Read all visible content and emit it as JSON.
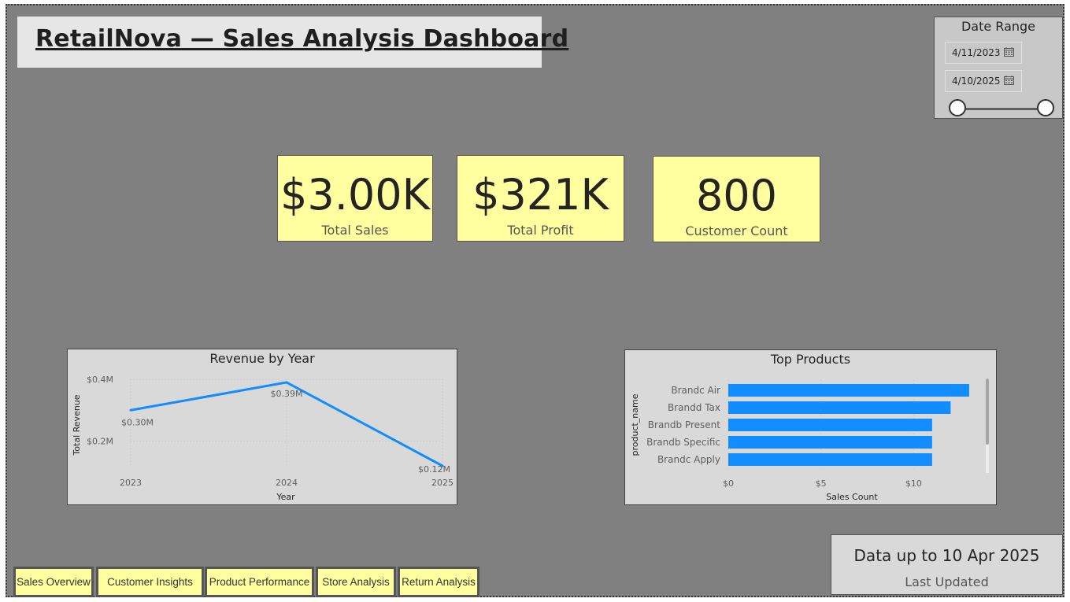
{
  "header": {
    "title": "RetailNova — Sales Analysis Dashboard"
  },
  "date_range": {
    "label": "Date Range",
    "start": "4/11/2023",
    "end": "4/10/2025",
    "calendar_icon": "calendar-icon",
    "slider_start_fraction": 0.0,
    "slider_end_fraction": 1.0
  },
  "kpis": [
    {
      "value": "$3.00K",
      "label": "Total Sales"
    },
    {
      "value": "$321K",
      "label": "Total Profit"
    },
    {
      "value": "800",
      "label": "Customer Count"
    }
  ],
  "colors": {
    "background": "#808080",
    "kpi_card": "#ffff9f",
    "chart_bg": "#d9d9d9",
    "series": "#118dff"
  },
  "chart_data": [
    {
      "type": "line",
      "title": "Revenue by Year",
      "xlabel": "Year",
      "ylabel": "Total Revenue",
      "x": [
        "2023",
        "2024",
        "2025"
      ],
      "values": [
        0.3,
        0.39,
        0.12
      ],
      "data_labels": [
        "$0.30M",
        "$0.39M",
        "$0.12M"
      ],
      "y_ticks": [
        {
          "value": 0.2,
          "label": "$0.2M"
        },
        {
          "value": 0.4,
          "label": "$0.4M"
        }
      ],
      "ylim": [
        0.12,
        0.4
      ],
      "grid": true
    },
    {
      "type": "bar",
      "orientation": "horizontal",
      "title": "Top Products",
      "xlabel": "Sales Count",
      "ylabel": "product_name",
      "categories": [
        "Brandc Air",
        "Brandd Tax",
        "Brandb Present",
        "Brandb Specific",
        "Brandc Apply"
      ],
      "values": [
        13,
        12,
        11,
        11,
        11
      ],
      "x_ticks": [
        {
          "value": 0,
          "label": "$0"
        },
        {
          "value": 5,
          "label": "$5"
        },
        {
          "value": 10,
          "label": "$10"
        }
      ],
      "xlim": [
        0,
        13.3
      ],
      "grid": true
    }
  ],
  "nav": {
    "buttons": [
      "Sales Overview",
      "Customer Insights",
      "Product Performance",
      "Store Analysis",
      "Return Analysis"
    ]
  },
  "status": {
    "data_up_to": "Data up to 10 Apr 2025",
    "last_updated_label": "Last Updated"
  }
}
